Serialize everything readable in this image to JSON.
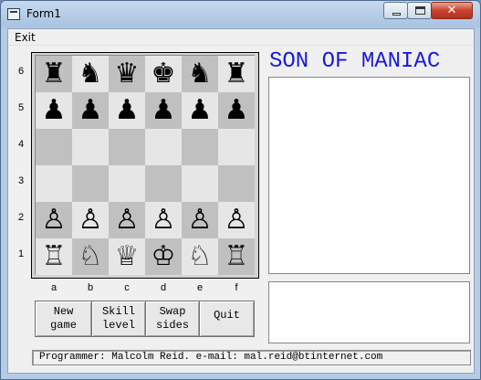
{
  "window": {
    "title": "Form1"
  },
  "menu": {
    "exit": "Exit"
  },
  "heading": "SON OF MANIAC",
  "ranks": [
    "6",
    "5",
    "4",
    "3",
    "2",
    "1"
  ],
  "files": [
    "a",
    "b",
    "c",
    "d",
    "e",
    "f"
  ],
  "board": {
    "rows": [
      [
        "♜",
        "♞",
        "♛",
        "♚",
        "♞",
        "♜"
      ],
      [
        "♟",
        "♟",
        "♟",
        "♟",
        "♟",
        "♟"
      ],
      [
        "",
        "",
        "",
        "",
        "",
        ""
      ],
      [
        "",
        "",
        "",
        "",
        "",
        ""
      ],
      [
        "♙",
        "♙",
        "♙",
        "♙",
        "♙",
        "♙"
      ],
      [
        "♖",
        "♘",
        "♕",
        "♔",
        "♘",
        "♖"
      ]
    ]
  },
  "buttons": {
    "new_game": "New\ngame",
    "skill_level": "Skill\nlevel",
    "swap_sides": "Swap\nsides",
    "quit": "Quit"
  },
  "status": "Programmer: Malcolm Reid.  e-mail: mal.reid@btinternet.com",
  "colors": {
    "heading": "#1a1adb",
    "dark_square": "#c0c0c0",
    "light_square": "#e6e6e6"
  }
}
